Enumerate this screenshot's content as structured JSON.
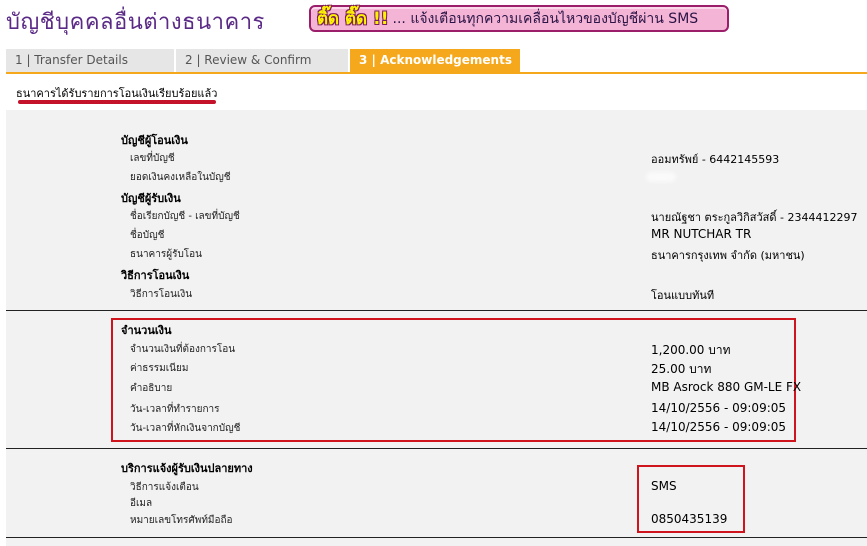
{
  "header": {
    "title": "บัญชีบุคคลอื่นต่างธนาคาร",
    "sms_badge": "ติ๊ด ติ๊ด !!",
    "sms_text": "... แจ้งเตือนทุกความเคลื่อนไหวของบัญชีผ่าน SMS"
  },
  "tabs": [
    {
      "label": "1 | Transfer Details"
    },
    {
      "label": "2 | Review & Confirm"
    },
    {
      "label": "3 | Acknowledgements"
    }
  ],
  "ack_message": "ธนาคารได้รับรายการโอนเงินเรียบร้อยแล้ว",
  "from_account": {
    "title": "บัญชีผู้โอนเงิน",
    "account_no_label": "เลขที่บัญชี",
    "account_no_value": "ออมทรัพย์ - 6442145593",
    "balance_label": "ยอดเงินคงเหลือในบัญชี"
  },
  "to_account": {
    "title": "บัญชีผู้รับเงิน",
    "nickname_label": "ชื่อเรียกบัญชี - เลขที่บัญชี",
    "nickname_value": "นายณัฐชา ตระกูลวิกิสวัสดิ์ - 2344412297",
    "name_label": "ชื่อบัญชี",
    "name_value": "MR NUTCHAR TR",
    "bank_label": "ธนาคารผู้รับโอน",
    "bank_value": "ธนาคารกรุงเทพ จำกัด (มหาชน)"
  },
  "method": {
    "title": "วิธีการโอนเงิน",
    "label": "วิธีการโอนเงิน",
    "value": "โอนแบบทันที"
  },
  "amount": {
    "title": "จำนวนเงิน",
    "amount_label": "จำนวนเงินที่ต้องการโอน",
    "amount_value": "1,200.00  บาท",
    "fee_label": "ค่าธรรมเนียม",
    "fee_value": "25.00  บาท",
    "desc_label": "คำอธิบาย",
    "desc_value": "MB Asrock 880 GM-LE FX",
    "txn_time_label": "วัน-เวลาที่ทำรายการ",
    "txn_time_value": "14/10/2556 - 09:09:05",
    "debit_time_label": "วัน-เวลาที่หักเงินจากบัญชี",
    "debit_time_value": "14/10/2556 - 09:09:05"
  },
  "notify": {
    "title": "บริการแจ้งผู้รับเงินปลายทาง",
    "method_label": "วิธีการแจ้งเตือน",
    "method_value": "SMS",
    "email_label": "อีเมล",
    "phone_label": "หมายเลขโทรศัพท์มือถือ",
    "phone_value": "0850435139"
  },
  "colors": {
    "title": "#5b2a86",
    "active_tab": "#f6a81c",
    "highlight": "#d0141e"
  }
}
